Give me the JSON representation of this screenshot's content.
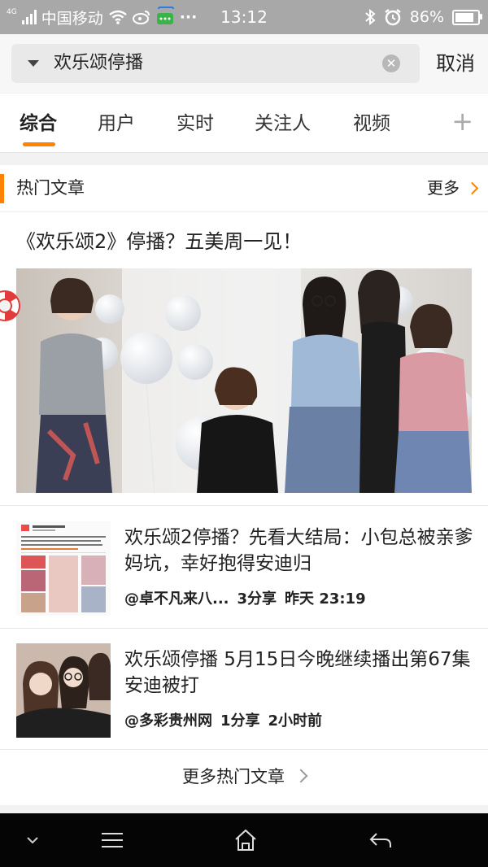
{
  "status_bar": {
    "network": "4G",
    "carrier": "中国移动",
    "time": "13:12",
    "battery": "86%",
    "more_dots": "···"
  },
  "search": {
    "query": "欢乐颂停播",
    "cancel_label": "取消"
  },
  "tabs": [
    {
      "label": "综合",
      "active": true
    },
    {
      "label": "用户",
      "active": false
    },
    {
      "label": "实时",
      "active": false
    },
    {
      "label": "关注人",
      "active": false
    },
    {
      "label": "视频",
      "active": false
    }
  ],
  "section": {
    "title": "热门文章",
    "more_label": "更多"
  },
  "featured": {
    "title": "《欢乐颂2》停播？五美周一见！"
  },
  "articles": [
    {
      "title": "欢乐颂2停播？先看大结局：小包总被亲爹妈坑，幸好抱得安迪归",
      "source": "@卓不凡来八...",
      "shares": "3分享",
      "time": "昨天 23:19"
    },
    {
      "title": "欢乐颂停播 5月15日今晚继续播出第67集安迪被打",
      "source": "@多彩贵州网",
      "shares": "1分享",
      "time": "2小时前"
    }
  ],
  "more_articles_label": "更多热门文章",
  "colors": {
    "accent": "#ff8200",
    "status_bar": "#a8a8a8",
    "nav_bar": "#050505"
  },
  "icons": [
    "signal-icon",
    "wifi-icon",
    "weibo-icon",
    "message-icon",
    "bluetooth-icon",
    "alarm-icon",
    "battery-icon",
    "clear-icon",
    "plus-icon",
    "lifebuoy-icon",
    "menu-down-icon",
    "menu-icon",
    "home-icon",
    "back-icon"
  ]
}
